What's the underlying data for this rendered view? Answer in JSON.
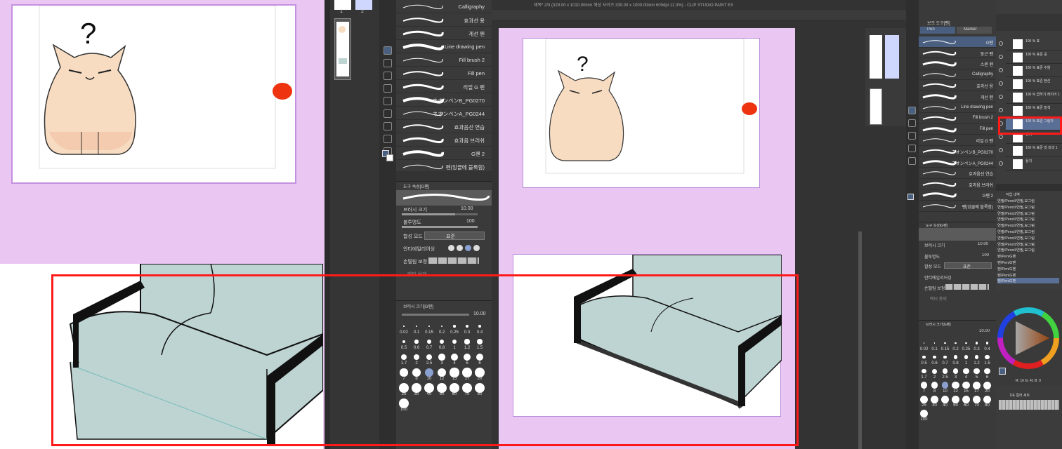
{
  "window": {
    "title": "제목* 2/3 (329.00 x 1010.00mm 해상 사이즈 330.00 x 1000.00mm 600dpi 12.3%) - CLIP STUDIO PAINT EX"
  },
  "pages": {
    "labels": [
      "1",
      "2"
    ],
    "active": "2"
  },
  "brush_list": [
    {
      "name": "Calligraphy"
    },
    {
      "name": "효과선 용"
    },
    {
      "name": "게선 펜"
    },
    {
      "name": "Line drawing pen"
    },
    {
      "name": "Fill brush 2"
    },
    {
      "name": "Fill pen"
    },
    {
      "name": "리얼 G 펜"
    },
    {
      "name": "ネオンペンB_PG0270"
    },
    {
      "name": "ネオンペンA_PG0244"
    },
    {
      "name": "효과음선 연습"
    },
    {
      "name": "효과음 브러쉬"
    },
    {
      "name": "G펜 2"
    },
    {
      "name": "펜(잉클에 블록함)"
    }
  ],
  "right_brush_list": [
    {
      "name": "G펜"
    },
    {
      "name": "둥근 펜"
    },
    {
      "name": "스퀸 펜"
    },
    {
      "name": "Calligraphy"
    },
    {
      "name": "효과선 용"
    },
    {
      "name": "게선 펜"
    },
    {
      "name": "Line drawing pen"
    },
    {
      "name": "Fill brush 2"
    },
    {
      "name": "Fill pen"
    },
    {
      "name": "리얼 G 펜"
    },
    {
      "name": "ネオンペンB_PG0270"
    },
    {
      "name": "ネオンペンA_PG0244"
    },
    {
      "name": "효과음선 연습"
    },
    {
      "name": "효과음 브러쉬"
    },
    {
      "name": "G펜 2"
    },
    {
      "name": "펜(잉클에 블록함)"
    }
  ],
  "tool_property": {
    "header": "도구 속성[G펜]",
    "brush_size_label": "브러시 크기",
    "brush_size_value": "10.00",
    "opacity_label": "불투명도",
    "opacity_value": "100",
    "blend_label": "합성 모드",
    "blend_value": "표준",
    "antialias_label": "안티에일리어싱",
    "stabilize_label": "손떨림 보정",
    "vector_label": "벡터 용제"
  },
  "brush_size_panel": {
    "header": "브러시 크기[G펜]",
    "value": "10.00",
    "sizes": [
      "0.02",
      "0.1",
      "0.15",
      "0.2",
      "0.25",
      "0.3",
      "0.4",
      "0.5",
      "0.6",
      "0.7",
      "0.8",
      "1",
      "1.2",
      "1.5",
      "1.7",
      "2",
      "2.5",
      "3",
      "4",
      "5",
      "6",
      "7",
      "8",
      "10",
      "12",
      "15",
      "17",
      "20",
      "25",
      "30",
      "40",
      "50",
      "60",
      "70",
      "80",
      "100"
    ]
  },
  "sub_tool_tabs": [
    "Pen",
    "Marker"
  ],
  "sub_tool_header": "보조 도구[펜]",
  "layers": [
    {
      "text": "100 % 표"
    },
    {
      "text": "100 % 표준 공"
    },
    {
      "text": "100 % 표준 수염"
    },
    {
      "text": "100 % 표준 펜선"
    },
    {
      "text": "100 % 곱하기 레이어 1"
    },
    {
      "text": "100 % 표준 밑색"
    },
    {
      "text": "100 % 표준 그림자"
    },
    {
      "text": "펜터"
    },
    {
      "text": "100 % 표준 컷 외곽 1"
    },
    {
      "text": "용지"
    }
  ],
  "history": [
    "연필/Pencil/연필,묘그림",
    "연필/Pencil/연필,묘그림",
    "연필/Pencil/연필,묘그림",
    "연필/Pencil/연필,묘그림",
    "연필/Pencil/연필,묘그림",
    "연필/Pencil/연필,묘그림",
    "연필/Pencil/연필,묘그림",
    "연필/Pencil/연필,묘그림",
    "연필/Pencil/연필,묘그림",
    "펜/Pen/G펜",
    "펜/Pen/G펜",
    "펜/Pen/G펜",
    "펜/Pen/G펜",
    "펜/Pen/G펜"
  ],
  "history_header": "작업 내역",
  "color_set_label": "DE 컬러 세트",
  "color_readout": "R: 16 G: 41 B: 0",
  "colors": {
    "highlight": "#ff1a1a",
    "canvas_bg": "#eac7f3",
    "sofa": "#bdd4d2",
    "cat": "#f7dcc2",
    "accent_dot": "#ee3311"
  }
}
